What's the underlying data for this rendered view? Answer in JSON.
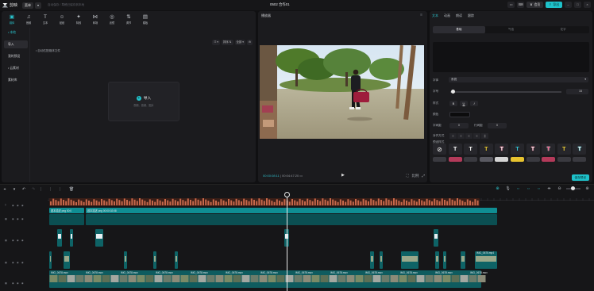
{
  "app": {
    "name": "剪映",
    "menu_label": "菜单",
    "autosave_text": "自动保存 / 草稿已保存到本地",
    "project_title": "0502 合作01",
    "export_label": "导出",
    "upgrade_label": "会员"
  },
  "toolbar_tabs": [
    {
      "label": "媒体",
      "icon": "media-icon",
      "glyph": "▣"
    },
    {
      "label": "音频",
      "icon": "audio-icon",
      "glyph": "♫"
    },
    {
      "label": "文本",
      "icon": "text-icon",
      "glyph": "T"
    },
    {
      "label": "贴纸",
      "icon": "sticker-icon",
      "glyph": "☺"
    },
    {
      "label": "特效",
      "icon": "effect-icon",
      "glyph": "✦"
    },
    {
      "label": "转场",
      "icon": "transition-icon",
      "glyph": "⋈"
    },
    {
      "label": "滤镜",
      "icon": "filter-icon",
      "glyph": "◎"
    },
    {
      "label": "调节",
      "icon": "adjust-icon",
      "glyph": "⇅"
    },
    {
      "label": "模板",
      "icon": "template-icon",
      "glyph": "▤"
    }
  ],
  "left_nav": [
    {
      "label": "• 本地",
      "style": "hl"
    },
    {
      "label": "导入",
      "style": "sel"
    },
    {
      "label": "我的预设",
      "style": ""
    },
    {
      "label": "• 云素材",
      "style": ""
    },
    {
      "label": "素材库",
      "style": ""
    }
  ],
  "library": {
    "header": "• 自动匹配媒体文件",
    "view_label": "☷ ▾",
    "sort_label": "排序 ⇅",
    "filter_label": "全部 ▾",
    "import_label": "导入",
    "import_sub": "视频、音频、图片"
  },
  "player": {
    "title": "播放器",
    "current_time": "00:00:08:11",
    "duration": "00:04:47:20",
    "ratio_label": "比例",
    "fullscreen_icon": "fullscreen-icon"
  },
  "inspector": {
    "tabs": [
      "文本",
      "动画",
      "朗读",
      "跟踪"
    ],
    "subtabs": [
      "基础",
      "气泡",
      "花字"
    ],
    "font_label": "字体",
    "font_value": "系统",
    "size_label": "字号",
    "size_value": "15",
    "style_label": "样式",
    "color_label": "颜色",
    "spacing_label": "字间距",
    "spacing_value": "0",
    "line_label": "行间距",
    "line_value": "0",
    "align_label": "对齐方式",
    "preset_label": "预设样式",
    "save_preset": "保存预设"
  },
  "colors": {
    "accent": "#2bc4cd",
    "track_teal": "#0e6f73",
    "track_text": "#0f8e93",
    "audio_orange": "#c8684a"
  },
  "tracks": {
    "labels": [
      "T",
      "▦",
      "▦",
      "▦",
      "▦"
    ],
    "text_clip_1": "题本描述 png  00:0",
    "text_clip_2": "题本描述 png  00:00:02:08",
    "main_clip_label": "IMG_0678.mov",
    "side_clip_label": "IMG_0678.mov",
    "end_clip_label": "IMG_0675.mp4"
  }
}
